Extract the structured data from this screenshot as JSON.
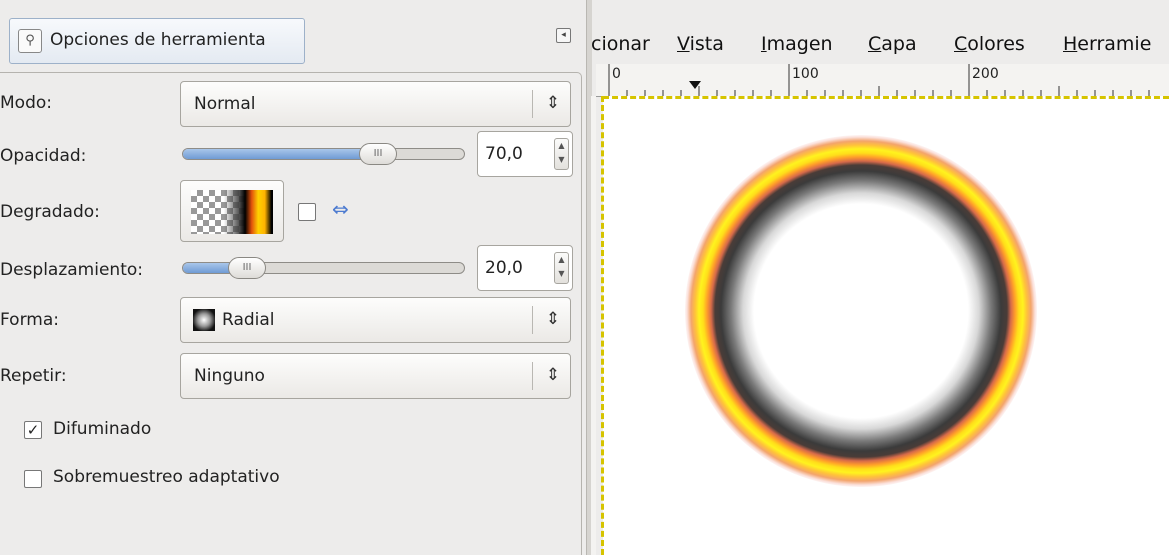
{
  "dock": {
    "tab_label": "Opciones de herramienta",
    "tab_icon": "tool-options-icon",
    "menu_icon": "dock-menu-icon"
  },
  "options": {
    "mode": {
      "label": "Modo:",
      "value": "Normal"
    },
    "opacity": {
      "label": "Opacidad:",
      "value": "70,0",
      "fraction": 0.7
    },
    "gradient": {
      "label": "Degradado:",
      "reverse_checked": false
    },
    "offset": {
      "label": "Desplazamiento:",
      "value": "20,0",
      "fraction": 0.2
    },
    "shape": {
      "label": "Forma:",
      "value": "Radial"
    },
    "repeat": {
      "label": "Repetir:",
      "value": "Ninguno"
    },
    "dither": {
      "label": "Difuminado",
      "checked": true
    },
    "adaptive": {
      "label": "Sobremuestreo adaptativo",
      "checked": false
    }
  },
  "image_window": {
    "menus": [
      {
        "label": "cionar",
        "mnemonic": ""
      },
      {
        "label": "Vista",
        "mnemonic": "V"
      },
      {
        "label": "Imagen",
        "mnemonic": "I"
      },
      {
        "label": "Capa",
        "mnemonic": "C"
      },
      {
        "label": "Colores",
        "mnemonic": "C"
      },
      {
        "label": "Herramie",
        "mnemonic": "H"
      }
    ],
    "ruler_labels": [
      "0",
      "100",
      "200"
    ]
  },
  "colors": {
    "slider_fill": "#6f9bd4",
    "selection_border": "#d6c400",
    "ring_yellow": "#ffde1a",
    "ring_orange": "#ff9d2a"
  }
}
